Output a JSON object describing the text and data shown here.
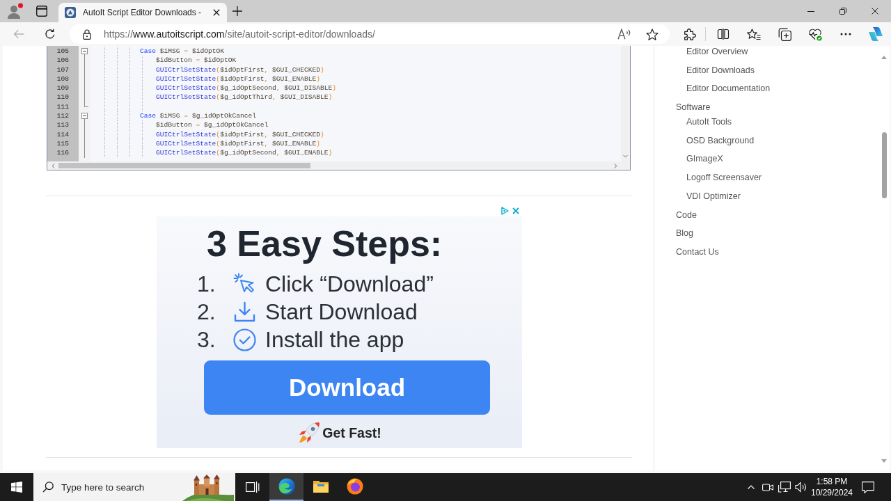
{
  "browser": {
    "tabs": [
      {
        "title": "AutoIt Script Editor Downloads -",
        "selected": true
      }
    ],
    "back_button": {
      "disabled": true
    },
    "address": {
      "scheme": "https://",
      "host": "www.autoitscript.com",
      "path": "/site/autoit-script-editor/downloads/"
    }
  },
  "code_editor": {
    "lines": [
      {
        "number": "105",
        "kind": "header",
        "tokens": [
          {
            "kind": "keyword",
            "text": "Case "
          },
          {
            "kind": "variable",
            "text": "$iMSG"
          },
          {
            "kind": "operator",
            "text": " = "
          },
          {
            "kind": "variable",
            "text": "$idOptOK"
          }
        ]
      },
      {
        "number": "106",
        "kind": "body",
        "tokens": [
          {
            "kind": "variable",
            "text": "$idButton"
          },
          {
            "kind": "operator",
            "text": " = "
          },
          {
            "kind": "variable",
            "text": "$idOptOK"
          }
        ]
      },
      {
        "number": "107",
        "kind": "body",
        "tokens": [
          {
            "kind": "function",
            "text": "GUICtrlSetState"
          },
          {
            "kind": "operator",
            "text": "("
          },
          {
            "kind": "variable",
            "text": "$idOptFirst"
          },
          {
            "kind": "operator",
            "text": ", "
          },
          {
            "kind": "variable",
            "text": "$GUI_CHECKED"
          },
          {
            "kind": "operator",
            "text": ")"
          }
        ]
      },
      {
        "number": "108",
        "kind": "body",
        "tokens": [
          {
            "kind": "function",
            "text": "GUICtrlSetState"
          },
          {
            "kind": "operator",
            "text": "("
          },
          {
            "kind": "variable",
            "text": "$idOptFirst"
          },
          {
            "kind": "operator",
            "text": ", "
          },
          {
            "kind": "variable",
            "text": "$GUI_ENABLE"
          },
          {
            "kind": "operator",
            "text": ")"
          }
        ]
      },
      {
        "number": "109",
        "kind": "body",
        "tokens": [
          {
            "kind": "function",
            "text": "GUICtrlSetState"
          },
          {
            "kind": "operator",
            "text": "("
          },
          {
            "kind": "variable",
            "text": "$g_idOptSecond"
          },
          {
            "kind": "operator",
            "text": ", "
          },
          {
            "kind": "variable",
            "text": "$GUI_DISABLE"
          },
          {
            "kind": "operator",
            "text": ")"
          }
        ]
      },
      {
        "number": "110",
        "kind": "body",
        "tokens": [
          {
            "kind": "function",
            "text": "GUICtrlSetState"
          },
          {
            "kind": "operator",
            "text": "("
          },
          {
            "kind": "variable",
            "text": "$g_idOptThird"
          },
          {
            "kind": "operator",
            "text": ", "
          },
          {
            "kind": "variable",
            "text": "$GUI_DISABLE"
          },
          {
            "kind": "operator",
            "text": ")"
          }
        ]
      },
      {
        "number": "111",
        "kind": "end"
      },
      {
        "number": "112",
        "kind": "header",
        "tokens": [
          {
            "kind": "keyword",
            "text": "Case "
          },
          {
            "kind": "variable",
            "text": "$iMSG"
          },
          {
            "kind": "operator",
            "text": " = "
          },
          {
            "kind": "variable",
            "text": "$g_idOptOkCancel"
          }
        ]
      },
      {
        "number": "113",
        "kind": "body",
        "tokens": [
          {
            "kind": "variable",
            "text": "$idButton"
          },
          {
            "kind": "operator",
            "text": " = "
          },
          {
            "kind": "variable",
            "text": "$g_idOptOkCancel"
          }
        ]
      },
      {
        "number": "114",
        "kind": "body",
        "tokens": [
          {
            "kind": "function",
            "text": "GUICtrlSetState"
          },
          {
            "kind": "operator",
            "text": "("
          },
          {
            "kind": "variable",
            "text": "$idOptFirst"
          },
          {
            "kind": "operator",
            "text": ", "
          },
          {
            "kind": "variable",
            "text": "$GUI_CHECKED"
          },
          {
            "kind": "operator",
            "text": ")"
          }
        ]
      },
      {
        "number": "115",
        "kind": "body",
        "tokens": [
          {
            "kind": "function",
            "text": "GUICtrlSetState"
          },
          {
            "kind": "operator",
            "text": "("
          },
          {
            "kind": "variable",
            "text": "$idOptFirst"
          },
          {
            "kind": "operator",
            "text": ", "
          },
          {
            "kind": "variable",
            "text": "$GUI_ENABLE"
          },
          {
            "kind": "operator",
            "text": ")"
          }
        ]
      },
      {
        "number": "116",
        "kind": "body",
        "tokens": [
          {
            "kind": "function",
            "text": "GUICtrlSetState"
          },
          {
            "kind": "operator",
            "text": "("
          },
          {
            "kind": "variable",
            "text": "$g_idOptSecond"
          },
          {
            "kind": "operator",
            "text": ", "
          },
          {
            "kind": "variable",
            "text": "$GUI_ENABLE"
          },
          {
            "kind": "operator",
            "text": ")"
          }
        ]
      }
    ]
  },
  "ad": {
    "headline": "3 Easy Steps:",
    "steps": [
      {
        "number": "1.",
        "kind": "click",
        "text": "Click “Download”"
      },
      {
        "number": "2.",
        "kind": "download",
        "text": "Start Download"
      },
      {
        "number": "3.",
        "kind": "install",
        "text": "Install the app"
      }
    ],
    "button": "Download",
    "tagline": "Get Fast!"
  },
  "sidebar": {
    "items": [
      {
        "children": [
          {
            "label": "Editor Overview"
          },
          {
            "label": "Editor Downloads"
          },
          {
            "label": "Editor Documentation"
          }
        ]
      },
      {
        "label": "Software",
        "children": [
          {
            "label": "AutoIt Tools"
          },
          {
            "label": "OSD Background"
          },
          {
            "label": "GImageX"
          },
          {
            "label": "Logoff Screensaver"
          },
          {
            "label": "VDI Optimizer"
          }
        ]
      },
      {
        "label": "Code"
      },
      {
        "label": "Blog"
      },
      {
        "label": "Contact Us"
      }
    ]
  },
  "taskbar": {
    "search": {
      "placeholder": "Type here to search"
    },
    "apps": [
      {
        "kind": "edge",
        "selected": true
      },
      {
        "kind": "explorer",
        "selected": false
      },
      {
        "kind": "firefox",
        "selected": false
      }
    ],
    "clock": {
      "time": "1:58 PM",
      "date": "10/29/2024"
    }
  }
}
